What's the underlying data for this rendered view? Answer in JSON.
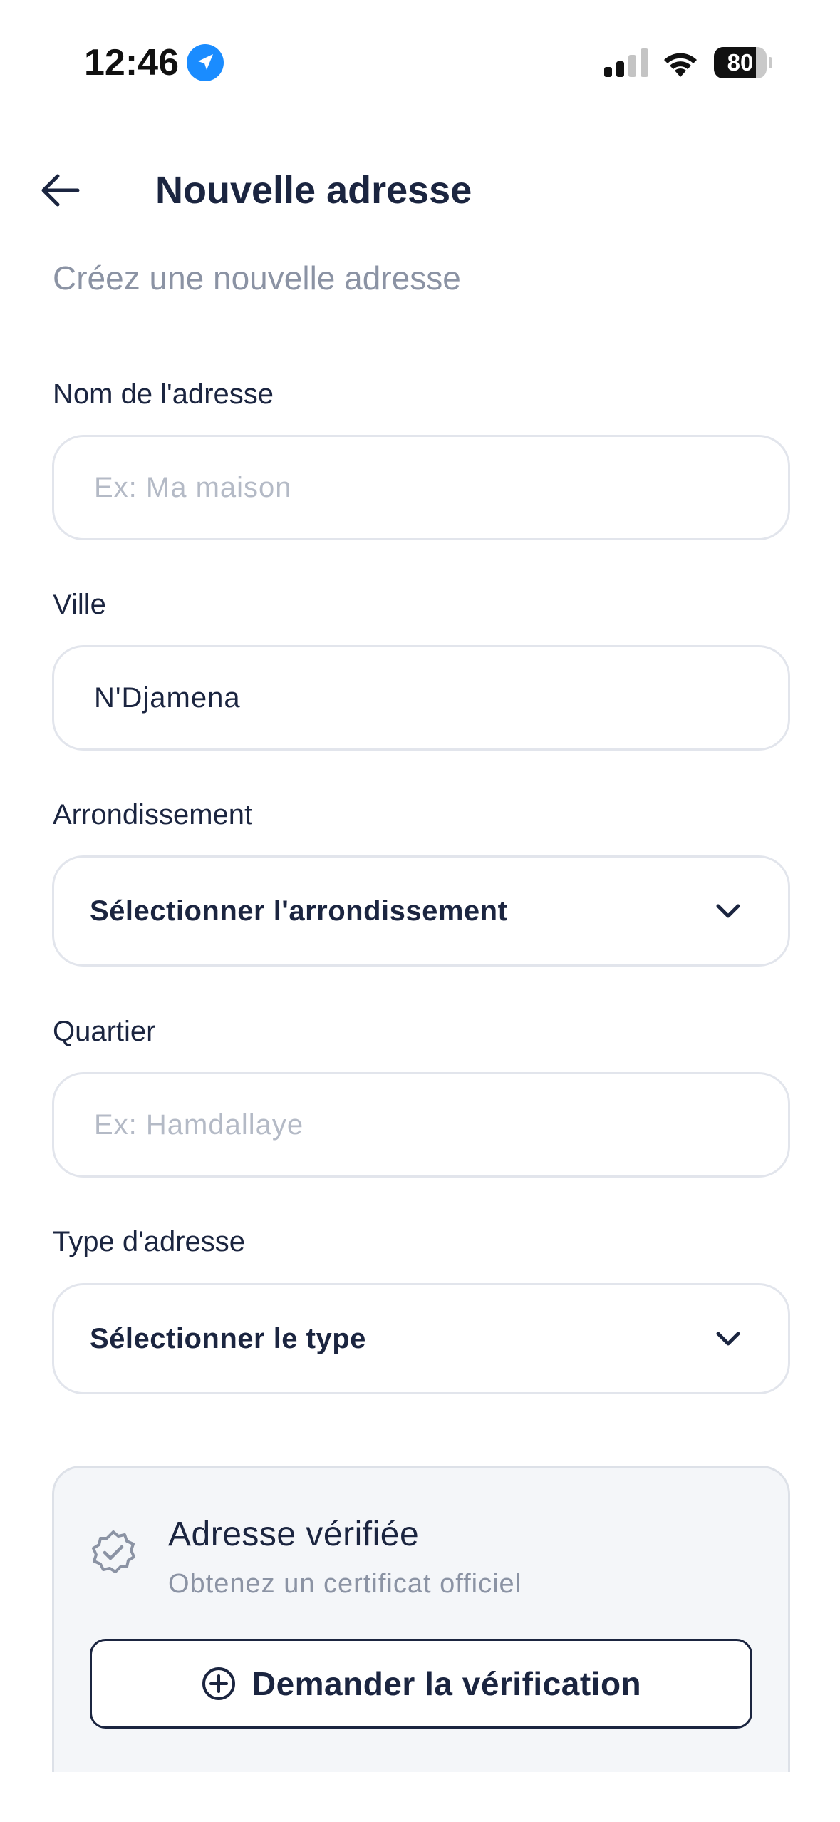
{
  "status_bar": {
    "time": "12:46",
    "battery_percent": 80,
    "battery_label": "80",
    "location_color": "#1a8cff"
  },
  "header": {
    "back_icon": "arrow-left-icon",
    "title": "Nouvelle adresse"
  },
  "subtitle": "Créez une nouvelle adresse",
  "form": {
    "name": {
      "label": "Nom de l'adresse",
      "value": "",
      "placeholder": "Ex: Ma maison"
    },
    "city": {
      "label": "Ville",
      "value": "N'Djamena",
      "placeholder": ""
    },
    "district": {
      "label": "Arrondissement",
      "selected": "Sélectionner l'arrondissement",
      "icon": "chevron-down-icon"
    },
    "neighborhood": {
      "label": "Quartier",
      "value": "",
      "placeholder": "Ex: Hamdallaye"
    },
    "address_type": {
      "label": "Type d'adresse",
      "selected": "Sélectionner le type",
      "icon": "chevron-down-icon"
    }
  },
  "verification": {
    "icon": "verified-badge-icon",
    "title": "Adresse vérifiée",
    "subtitle": "Obtenez un certificat officiel",
    "button_icon": "plus-circle-icon",
    "button_label": "Demander la vérification"
  },
  "colors": {
    "text_primary": "#1b2540",
    "text_muted": "#8b93a4",
    "border": "#e2e5ec",
    "card_bg": "#f4f6f9"
  }
}
